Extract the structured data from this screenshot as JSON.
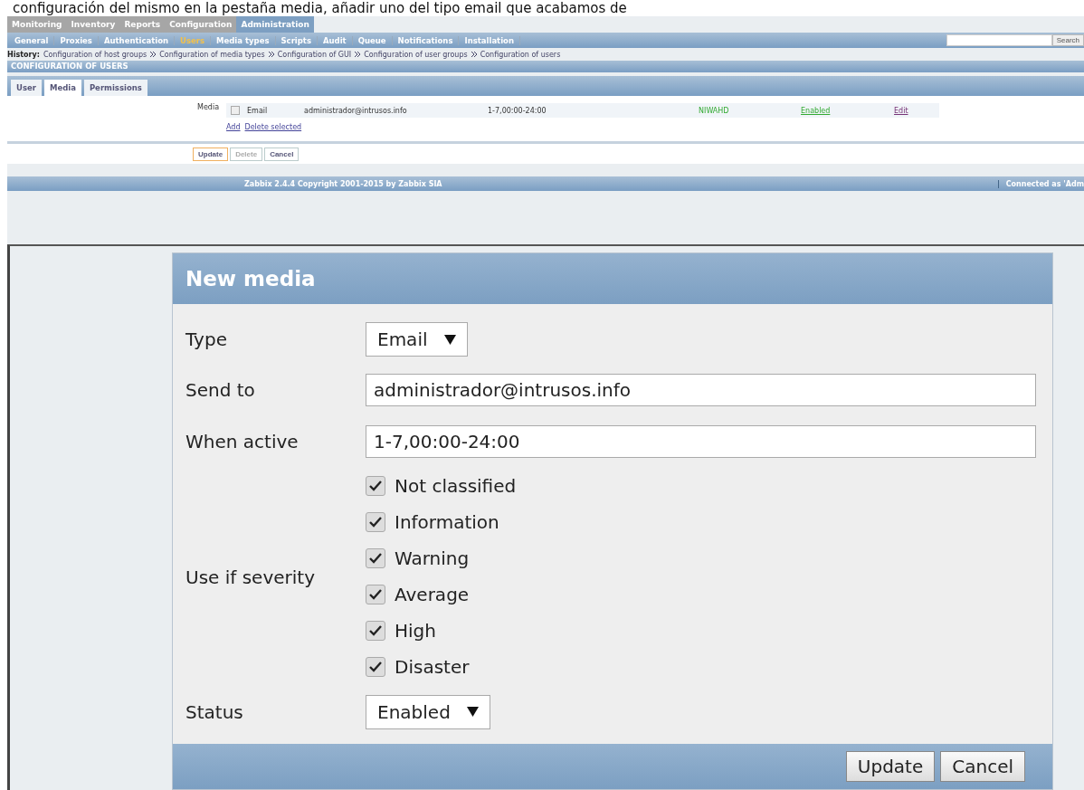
{
  "caption": "configuración del mismo en la pestaña media, añadir uno del tipo email que acabamos de",
  "menu": [
    {
      "label": "Monitoring",
      "selected": false
    },
    {
      "label": "Inventory",
      "selected": false
    },
    {
      "label": "Reports",
      "selected": false
    },
    {
      "label": "Configuration",
      "selected": false
    },
    {
      "label": "Administration",
      "selected": true
    }
  ],
  "submenu": [
    {
      "label": "General",
      "selected": false
    },
    {
      "label": "Proxies",
      "selected": false
    },
    {
      "label": "Authentication",
      "selected": false
    },
    {
      "label": "Users",
      "selected": true
    },
    {
      "label": "Media types",
      "selected": false
    },
    {
      "label": "Scripts",
      "selected": false
    },
    {
      "label": "Audit",
      "selected": false
    },
    {
      "label": "Queue",
      "selected": false
    },
    {
      "label": "Notifications",
      "selected": false
    },
    {
      "label": "Installation",
      "selected": false
    }
  ],
  "search_button": "Search",
  "history": {
    "label": "History:",
    "items": [
      "Configuration of host groups",
      "Configuration of media types",
      "Configuration of GUI",
      "Configuration of user groups",
      "Configuration of users"
    ]
  },
  "section_title": "CONFIGURATION OF USERS",
  "tabs": [
    {
      "label": "User",
      "selected": false
    },
    {
      "label": "Media",
      "selected": true
    },
    {
      "label": "Permissions",
      "selected": false
    }
  ],
  "media": {
    "label": "Media",
    "row": {
      "checked": false,
      "type": "Email",
      "send_to": "administrador@intrusos.info",
      "when_active": "1-7,00:00-24:00",
      "severity": "NIWAHD",
      "status": "Enabled",
      "edit": "Edit"
    },
    "add": "Add",
    "delete_selected": "Delete selected"
  },
  "form_buttons": [
    {
      "label": "Update",
      "kind": "primary",
      "disabled": false
    },
    {
      "label": "Delete",
      "kind": "normal",
      "disabled": true
    },
    {
      "label": "Cancel",
      "kind": "normal",
      "disabled": false
    }
  ],
  "footer": {
    "copyright": "Zabbix 2.4.4 Copyright 2001-2015 by Zabbix SIA",
    "connected": "Connected as 'Adm"
  },
  "dialog": {
    "title": "New media",
    "type": {
      "label": "Type",
      "value": "Email"
    },
    "send_to": {
      "label": "Send to",
      "value": "administrador@intrusos.info"
    },
    "when_active": {
      "label": "When active",
      "value": "1-7,00:00-24:00"
    },
    "severity": {
      "label": "Use if severity",
      "options": [
        {
          "label": "Not classified",
          "checked": true
        },
        {
          "label": "Information",
          "checked": true
        },
        {
          "label": "Warning",
          "checked": true
        },
        {
          "label": "Average",
          "checked": true
        },
        {
          "label": "High",
          "checked": true
        },
        {
          "label": "Disaster",
          "checked": true
        }
      ]
    },
    "status": {
      "label": "Status",
      "value": "Enabled"
    },
    "buttons": [
      "Update",
      "Cancel"
    ]
  }
}
